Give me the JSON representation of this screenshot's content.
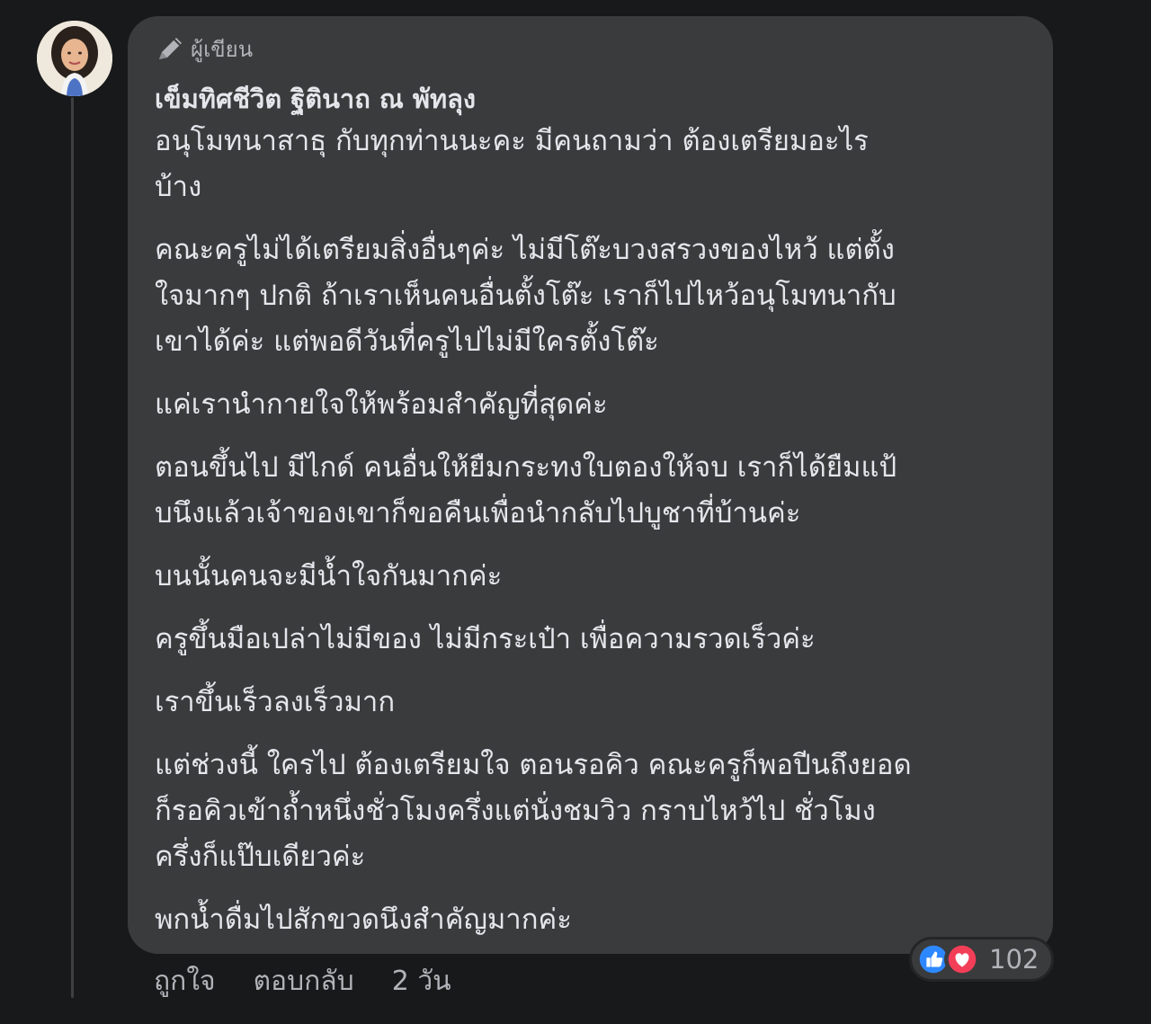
{
  "comment": {
    "badge_icon": "pen-icon",
    "badge_label": "ผู้เขียน",
    "author_name": "เข็มทิศชีวิต ฐิตินาถ ณ พัทลุง",
    "paragraphs": [
      [
        "อนุโมทนาสาธุ กับทุกท่านนะคะ มีคนถามว่า ต้องเตรียมอะไร",
        "บ้าง"
      ],
      [
        "คณะครูไม่ได้เตรียมสิ่งอื่นๆค่ะ ไม่มีโต๊ะบวงสรวงของไหว้ แต่ตั้ง",
        "ใจมากๆ ปกติ ถ้าเราเห็นคนอื่นตั้งโต๊ะ เราก็ไปไหว้อนุโมทนากับ",
        "เขาได้ค่ะ แต่พอดีวันที่ครูไปไม่มีใครตั้งโต๊ะ"
      ],
      [
        "แค่เรานำกายใจให้พร้อมสำคัญที่สุดค่ะ"
      ],
      [
        "ตอนขึ้นไป มีไกด์ คนอื่นให้ยืมกระทงใบตองให้จบ เราก็ได้ยืมแป้",
        "บนึงแล้วเจ้าของเขาก็ขอคืนเพื่อนำกลับไปบูชาที่บ้านค่ะ"
      ],
      [
        "บนนั้นคนจะมีน้ำใจกันมากค่ะ"
      ],
      [
        "ครูขึ้นมือเปล่าไม่มีของ ไม่มีกระเป๋า เพื่อความรวดเร็วค่ะ"
      ],
      [
        "เราขึ้นเร็วลงเร็วมาก"
      ],
      [
        "แต่ช่วงนี้ ใครไป ต้องเตรียมใจ ตอนรอคิว คณะครูก็พอปีนถึงยอด",
        "ก็รอคิวเข้าถ้ำหนึ่งชั่วโมงครึ่งแต่นั่งชมวิว กราบไหว้ไป ชั่วโมง",
        "ครึ่งก็แป๊บเดียวค่ะ"
      ],
      [
        "พกน้ำดื่มไปสักขวดนึงสำคัญมากค่ะ"
      ]
    ]
  },
  "reactions": {
    "icons": [
      "like-icon",
      "love-icon"
    ],
    "count": "102",
    "colors": {
      "like": "#2d88ff",
      "love": "#f33e58"
    }
  },
  "actions": {
    "like_label": "ถูกใจ",
    "reply_label": "ตอบกลับ",
    "time": "2 วัน"
  },
  "colors": {
    "background": "#18191a",
    "bubble": "#3a3b3c",
    "text_primary": "#e4e6eb",
    "text_secondary": "#b0b3b8"
  }
}
